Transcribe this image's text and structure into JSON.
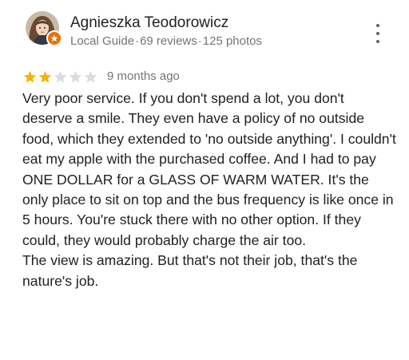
{
  "reviewer": {
    "name": "Agnieszka Teodorowicz",
    "badge": "Local Guide",
    "reviews": "69 reviews",
    "photos": "125 photos",
    "separator": "·"
  },
  "review": {
    "rating": 2,
    "max_rating": 5,
    "time": "9 months ago",
    "paragraphs": [
      "Very poor service. If you don't spend a lot, you don't deserve a smile. They even have a policy of no outside food, which they extended to 'no outside anything'. I couldn't eat my apple with the purchased coffee. And I had to pay ONE DOLLAR for a GLASS OF WARM WATER. It's the only place to sit on top and the bus frequency is like once in 5 hours. You're stuck there with no other option. If they could, they would probably charge the air too.",
      "The view is amazing. But that's not their job, that's the nature's job."
    ]
  },
  "colors": {
    "star_filled": "#f4b400",
    "star_empty": "#dadce0",
    "meta_text": "#70757a",
    "primary_text": "#202124",
    "badge": "#e8710a"
  },
  "icons": {
    "more": "more-vertical-icon",
    "badge": "local-guide-badge-icon",
    "star": "star-icon"
  }
}
